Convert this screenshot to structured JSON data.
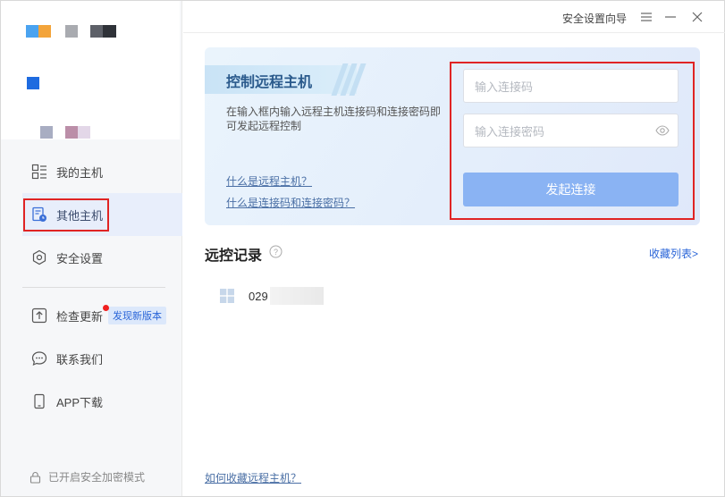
{
  "colors": {
    "accent": "#2a65d8",
    "highlight": "#e02424",
    "connect_button": "#8ab3f3"
  },
  "titlebar": {
    "wizard_label": "安全设置向导",
    "icons": [
      "menu-icon",
      "minimize-icon",
      "close-icon"
    ]
  },
  "sidebar": {
    "items": [
      {
        "label": "我的主机",
        "icon": "grid-list-icon"
      },
      {
        "label": "其他主机",
        "icon": "document-clock-icon"
      },
      {
        "label": "安全设置",
        "icon": "hexagon-shield-icon"
      },
      {
        "label": "检查更新",
        "icon": "upload-arrow-icon",
        "badge": "发现新版本"
      },
      {
        "label": "联系我们",
        "icon": "chat-bubble-icon"
      },
      {
        "label": "APP下载",
        "icon": "phone-icon"
      }
    ],
    "footer": "已开启安全加密模式"
  },
  "card": {
    "title": "控制远程主机",
    "description": "在输入框内输入远程主机连接码和连接密码即可发起远程控制",
    "link1": "什么是远程主机？",
    "link2": "什么是连接码和连接密码？",
    "code_placeholder": "输入连接码",
    "password_placeholder": "输入连接密码",
    "connect_label": "发起连接"
  },
  "records": {
    "title": "远控记录",
    "favorites_link": "收藏列表>",
    "items": [
      {
        "text": "029"
      }
    ]
  },
  "bottom_link": "如何收藏远程主机？"
}
